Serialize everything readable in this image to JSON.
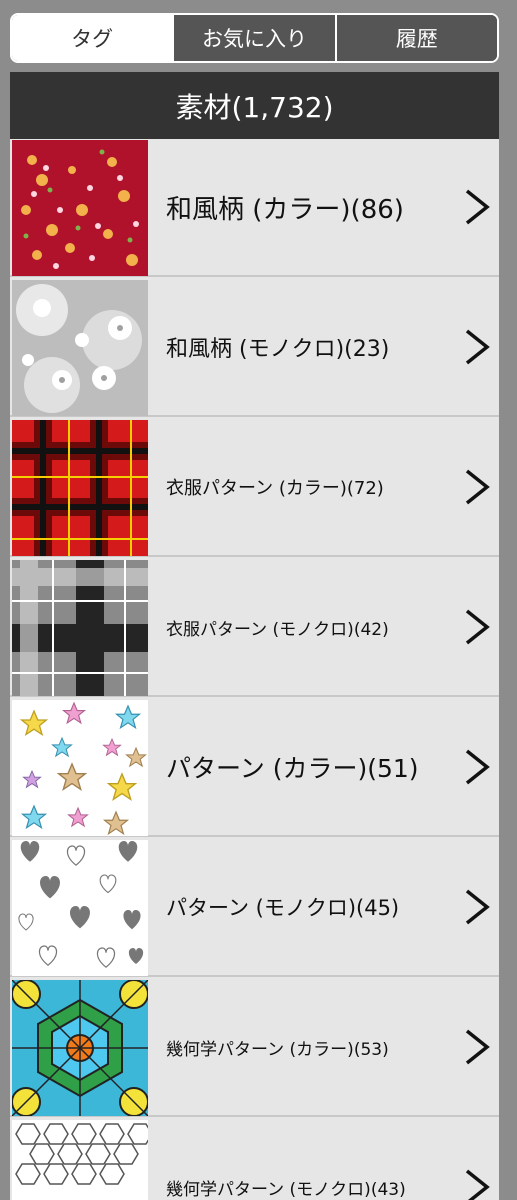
{
  "tabs": [
    {
      "label": "タグ",
      "active": true
    },
    {
      "label": "お気に入り",
      "active": false
    },
    {
      "label": "履歴",
      "active": false
    }
  ],
  "header": {
    "title": "素材(1,732)"
  },
  "items": [
    {
      "label": "和風柄 (カラー)(86)"
    },
    {
      "label": "和風柄 (モノクロ)(23)"
    },
    {
      "label": "衣服パターン (カラー)(72)"
    },
    {
      "label": "衣服パターン (モノクロ)(42)"
    },
    {
      "label": "パターン (カラー)(51)"
    },
    {
      "label": "パターン (モノクロ)(45)"
    },
    {
      "label": "幾何学パターン (カラー)(53)"
    },
    {
      "label": "幾何学パターン (モノクロ)(43)"
    }
  ],
  "icons": {
    "row_arrow": "chevron-right-icon"
  }
}
